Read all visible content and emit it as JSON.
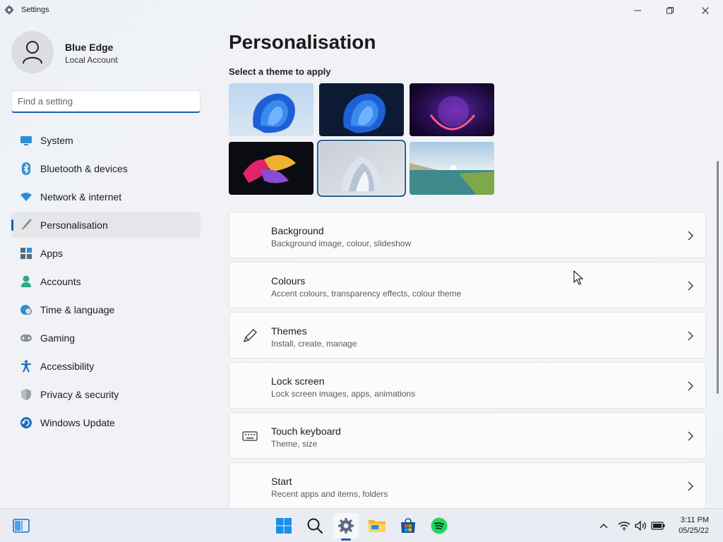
{
  "window": {
    "title": "Settings",
    "controls": {
      "minimize": "minimize-icon",
      "maximize": "restore-icon",
      "close": "close-icon"
    }
  },
  "user": {
    "name": "Blue Edge",
    "account_type": "Local Account"
  },
  "search": {
    "placeholder": "Find a setting",
    "value": ""
  },
  "sidebar": {
    "items": [
      {
        "label": "System",
        "icon": "monitor-icon",
        "active": false
      },
      {
        "label": "Bluetooth & devices",
        "icon": "bluetooth-icon",
        "active": false
      },
      {
        "label": "Network & internet",
        "icon": "wifi-icon",
        "active": false
      },
      {
        "label": "Personalisation",
        "icon": "brush-icon",
        "active": true
      },
      {
        "label": "Apps",
        "icon": "apps-icon",
        "active": false
      },
      {
        "label": "Accounts",
        "icon": "person-icon",
        "active": false
      },
      {
        "label": "Time & language",
        "icon": "globe-clock-icon",
        "active": false
      },
      {
        "label": "Gaming",
        "icon": "gamepad-icon",
        "active": false
      },
      {
        "label": "Accessibility",
        "icon": "accessibility-icon",
        "active": false
      },
      {
        "label": "Privacy & security",
        "icon": "shield-icon",
        "active": false
      },
      {
        "label": "Windows Update",
        "icon": "update-icon",
        "active": false
      }
    ]
  },
  "main": {
    "title": "Personalisation",
    "themes_label": "Select a theme to apply",
    "themes": [
      {
        "name": "windows-light-theme",
        "selected": false
      },
      {
        "name": "windows-dark-theme",
        "selected": false
      },
      {
        "name": "glow-theme",
        "selected": false
      },
      {
        "name": "captured-motion-theme",
        "selected": false
      },
      {
        "name": "sunrise-theme",
        "selected": true
      },
      {
        "name": "flow-theme",
        "selected": false
      }
    ],
    "cards": [
      {
        "title": "Background",
        "subtitle": "Background image, colour, slideshow",
        "icon": "image-icon"
      },
      {
        "title": "Colours",
        "subtitle": "Accent colours, transparency effects, colour theme",
        "icon": "palette-icon"
      },
      {
        "title": "Themes",
        "subtitle": "Install, create, manage",
        "icon": "pen-icon"
      },
      {
        "title": "Lock screen",
        "subtitle": "Lock screen images, apps, animations",
        "icon": "lock-screen-icon"
      },
      {
        "title": "Touch keyboard",
        "subtitle": "Theme, size",
        "icon": "keyboard-icon"
      },
      {
        "title": "Start",
        "subtitle": "Recent apps and items, folders",
        "icon": "start-icon"
      }
    ]
  },
  "taskbar": {
    "apps": [
      "widgets-icon",
      "start-icon",
      "search-icon",
      "settings-icon",
      "file-explorer-icon",
      "store-icon",
      "spotify-icon"
    ],
    "tray": [
      "chevron-up-icon",
      "wifi-icon",
      "volume-icon",
      "battery-icon"
    ],
    "time": "3:11 PM",
    "date": "05/25/22"
  },
  "colors": {
    "accent": "#1a5fb4",
    "background": "#eef1f6"
  }
}
